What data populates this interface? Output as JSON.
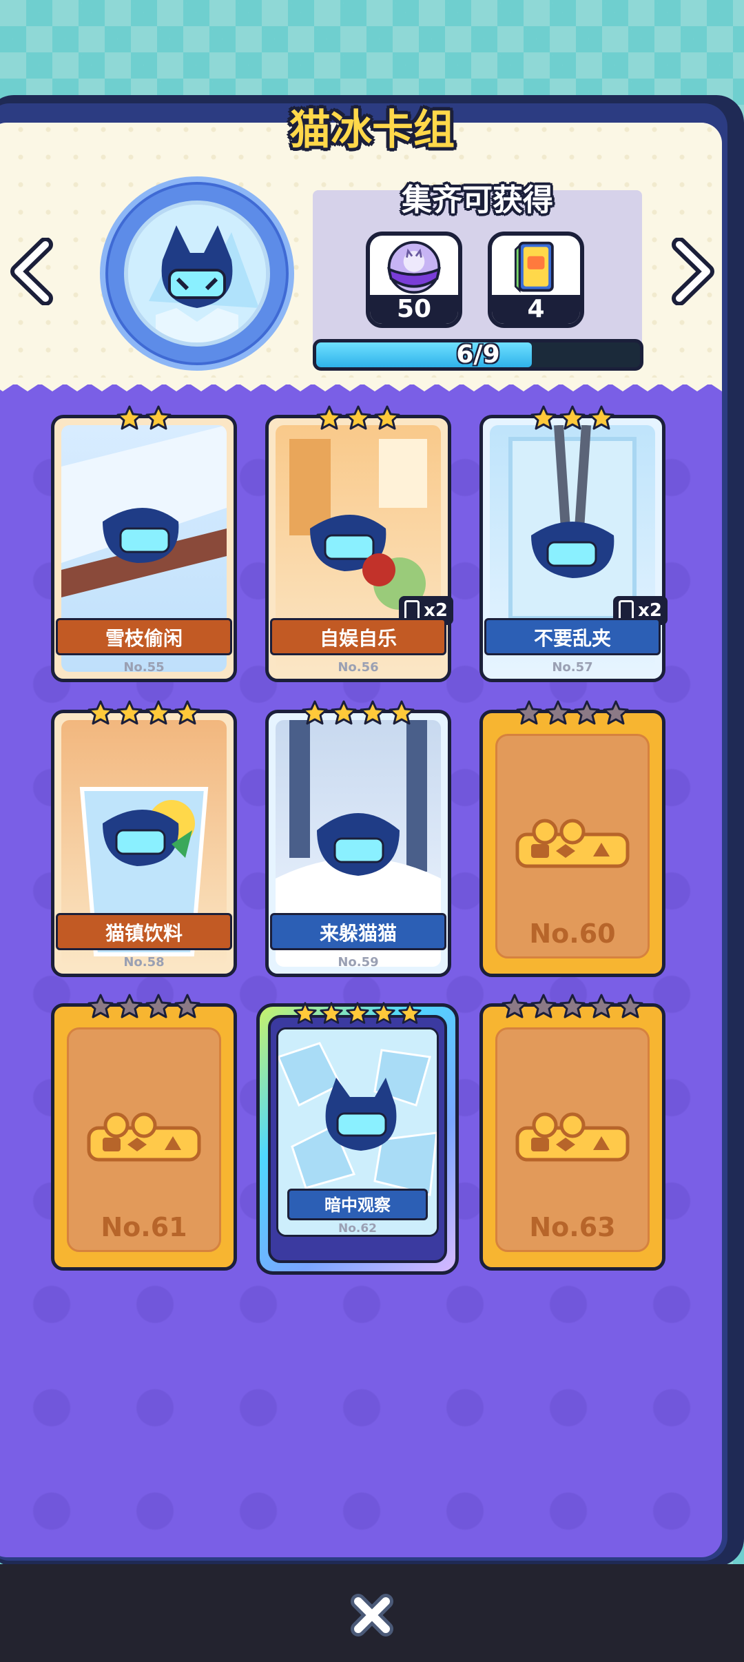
{
  "title": "猫冰卡组",
  "reward": {
    "title": "集齐可获得",
    "items": [
      {
        "icon": "cat-capsule-icon",
        "count": "50"
      },
      {
        "icon": "card-pack-icon",
        "count": "4"
      }
    ],
    "progress": {
      "text": "6/9",
      "current": 6,
      "total": 9
    }
  },
  "cards": [
    {
      "name": "雪枝偷闲",
      "no": "No.55",
      "stars": 2,
      "theme": "orange",
      "collected": true
    },
    {
      "name": "自娱自乐",
      "no": "No.56",
      "stars": 3,
      "theme": "orange",
      "collected": true,
      "dup": "x2"
    },
    {
      "name": "不要乱夹",
      "no": "No.57",
      "stars": 3,
      "theme": "blue",
      "collected": true,
      "dup": "x2"
    },
    {
      "name": "猫镇饮料",
      "no": "No.58",
      "stars": 4,
      "theme": "orange",
      "collected": true
    },
    {
      "name": "来躲猫猫",
      "no": "No.59",
      "stars": 4,
      "theme": "blue",
      "collected": true
    },
    {
      "name": "",
      "no": "No.60",
      "stars": 4,
      "theme": "locked",
      "collected": false
    },
    {
      "name": "",
      "no": "No.61",
      "stars": 4,
      "theme": "locked",
      "collected": false
    },
    {
      "name": "暗中观察",
      "no": "No.62",
      "stars": 5,
      "theme": "special",
      "collected": true
    },
    {
      "name": "",
      "no": "No.63",
      "stars": 5,
      "theme": "locked",
      "collected": false
    }
  ],
  "colors": {
    "star_gold": "#ffc93a",
    "star_gray": "#8c7a86",
    "accent_purple": "#7a5fe6",
    "title_yellow": "#ffd84a"
  }
}
